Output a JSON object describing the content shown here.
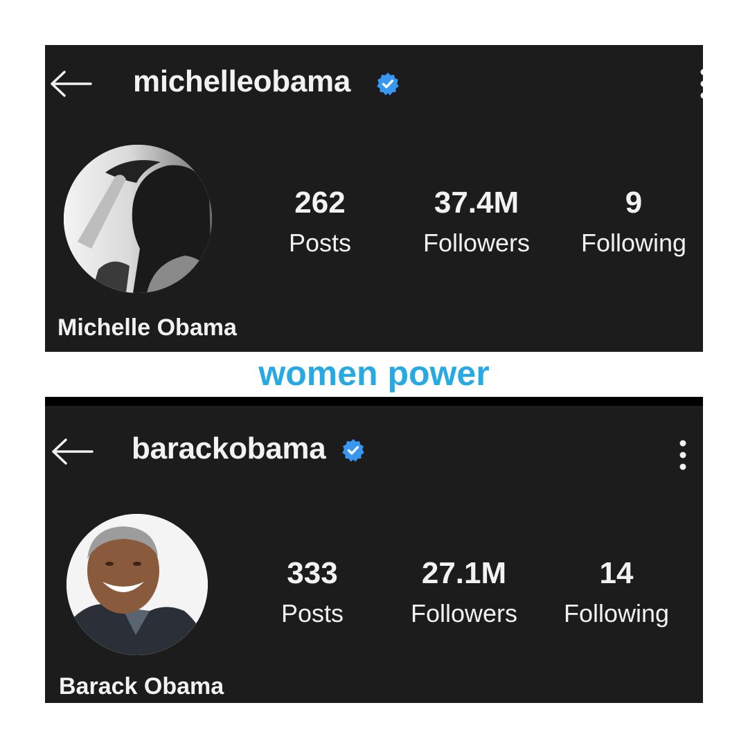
{
  "caption": {
    "text": "women power",
    "color": "#29a9e1"
  },
  "profiles": [
    {
      "handle": "michelleobama",
      "verified_icon": "verified-badge-icon",
      "stats": [
        {
          "value": "262",
          "label": "Posts"
        },
        {
          "value": "37.4M",
          "label": "Followers"
        },
        {
          "value": "9",
          "label": "Following"
        }
      ],
      "full_name": "Michelle Obama"
    },
    {
      "handle": "barackobama",
      "verified_icon": "verified-badge-icon",
      "stats": [
        {
          "value": "333",
          "label": "Posts"
        },
        {
          "value": "27.1M",
          "label": "Followers"
        },
        {
          "value": "14",
          "label": "Following"
        }
      ],
      "full_name": "Barack Obama"
    }
  ],
  "colors": {
    "panel_bg": "#1c1c1c",
    "text": "#f2f2f2",
    "badge": "#3897f0"
  }
}
